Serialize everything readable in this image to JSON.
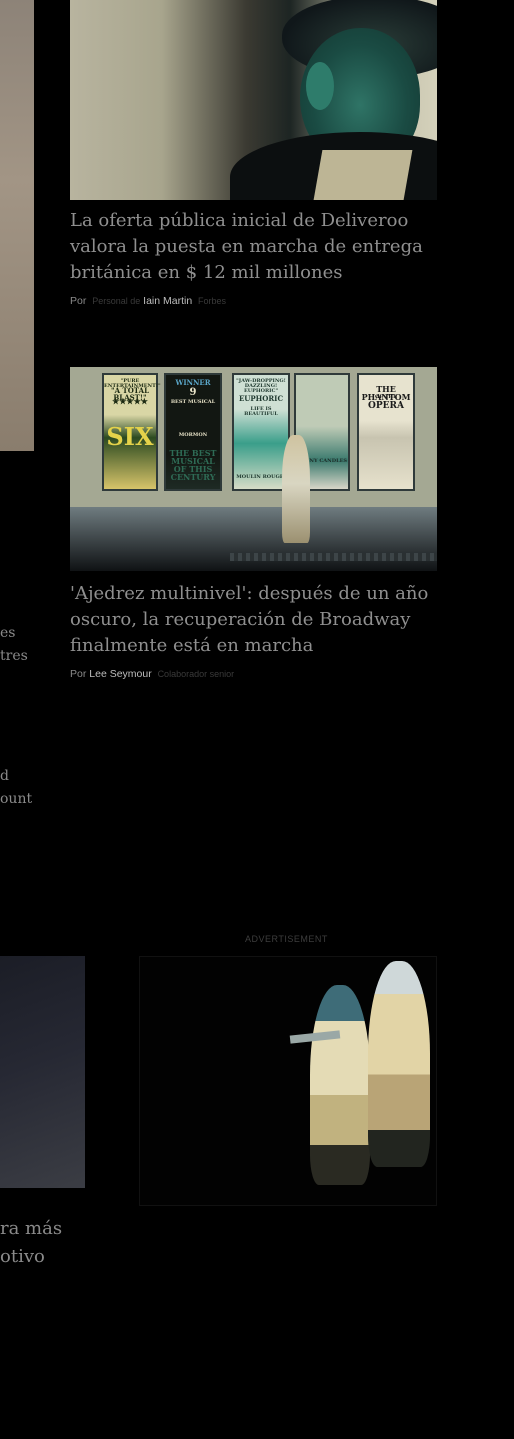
{
  "article1": {
    "title": "La oferta pública inicial de Deliveroo valora la puesta en marcha de entrega británica en $ 12 mil millones",
    "by": "Por",
    "role": "Personal de",
    "author": "Iain Martin",
    "outlet": "Forbes"
  },
  "article2": {
    "title": "'Ajedrez multinivel': después de un año oscuro, la recuperación de Broadway finalmente está en marcha",
    "by": "Por",
    "author": "Lee Seymour",
    "role": "Colaborador senior",
    "posters": {
      "p1_a": "\"PURE ENTERTAINMENT!\"",
      "p1_b": "\"A TOTAL BLAST!\"",
      "p1_c": "★★★★★",
      "p1_d": "SIX",
      "p2_a": "WINNER",
      "p2_b": "9",
      "p2_c": "BEST MUSICAL",
      "p2_d": "MORMON",
      "p2_e": "THE BEST MUSICAL OF THIS CENTURY",
      "p3_a": "\"JAW-DROPPING! DAZZLING! EUPHORIC\"",
      "p3_b": "EUPHORIC",
      "p3_c": "LIFE IS BEAUTIFUL",
      "p3_d": "MOULIN ROUGE!",
      "p4_a": "FUNNY CANDLES",
      "p5_a": "THE PHANTOM",
      "p5_b": "OF THE",
      "p5_c": "OPERA"
    }
  },
  "left_fragments": {
    "f1": "es",
    "f2": "tres",
    "f3": "d",
    "f4": "ount",
    "f5": "ra más",
    "f6": "otivo"
  },
  "ad": {
    "label": "ADVERTISEMENT"
  }
}
